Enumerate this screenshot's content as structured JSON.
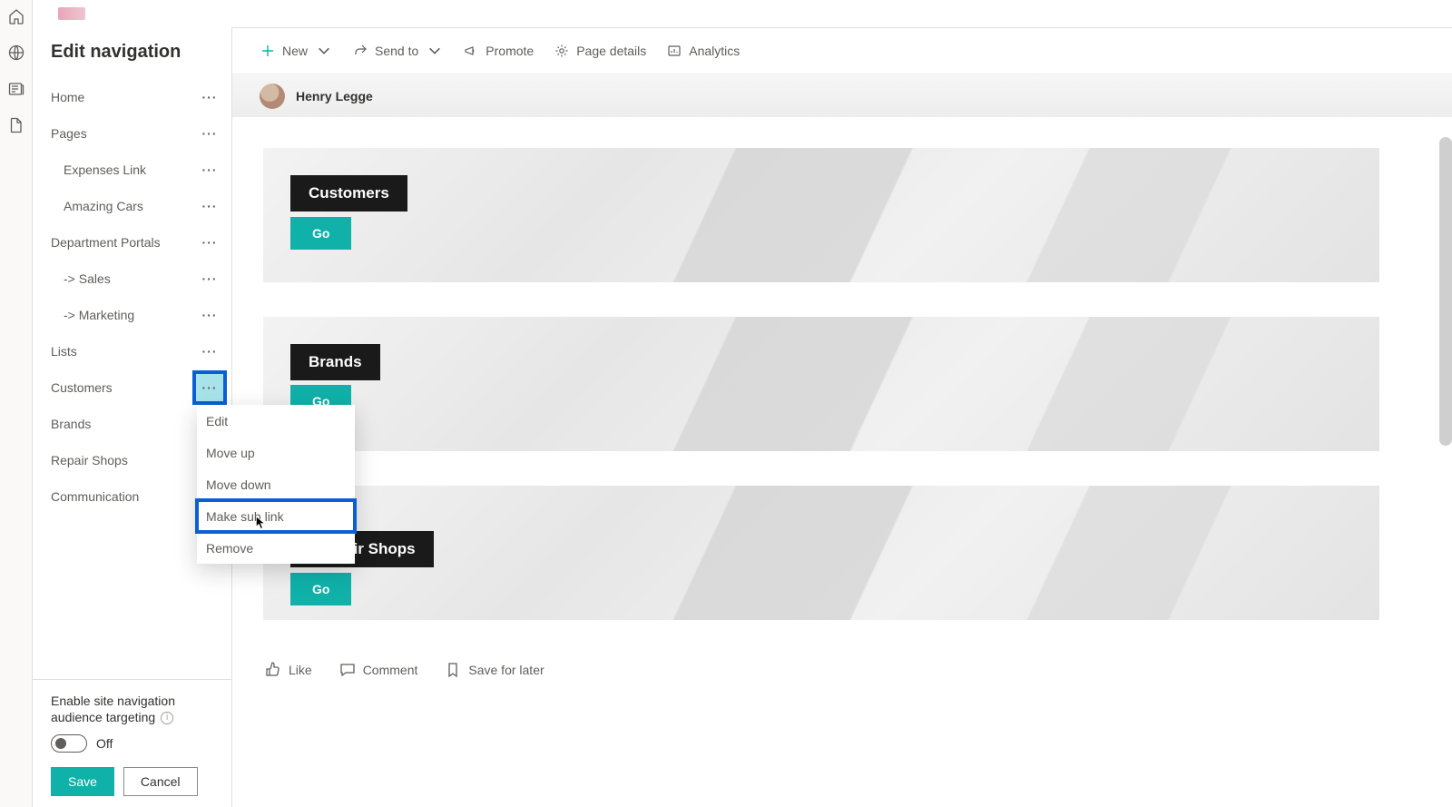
{
  "rail": {
    "items": [
      "home-icon",
      "globe-icon",
      "news-icon",
      "file-icon"
    ]
  },
  "panel": {
    "title": "Edit navigation",
    "items": [
      {
        "label": "Home",
        "indent": 0
      },
      {
        "label": "Pages",
        "indent": 0
      },
      {
        "label": "Expenses Link",
        "indent": 1
      },
      {
        "label": "Amazing Cars",
        "indent": 1
      },
      {
        "label": "Department Portals",
        "indent": 0
      },
      {
        "label": "-> Sales",
        "indent": 1
      },
      {
        "label": "-> Marketing",
        "indent": 1
      },
      {
        "label": "Lists",
        "indent": 0
      },
      {
        "label": "Customers",
        "indent": 0,
        "highlight": true
      },
      {
        "label": "Brands",
        "indent": 0
      },
      {
        "label": "Repair Shops",
        "indent": 0
      },
      {
        "label": "Communication",
        "indent": 0
      }
    ],
    "targeting": {
      "line1": "Enable site navigation",
      "line2": "audience targeting",
      "state": "Off"
    },
    "save": "Save",
    "cancel": "Cancel"
  },
  "contextMenu": {
    "items": [
      "Edit",
      "Move up",
      "Move down",
      "Make sub link",
      "Remove"
    ],
    "highlightIndex": 3
  },
  "commandBar": {
    "new": "New",
    "sendto": "Send to",
    "promote": "Promote",
    "pagedetails": "Page details",
    "analytics": "Analytics"
  },
  "author": {
    "name": "Henry Legge"
  },
  "tiles": [
    {
      "title": "Customers",
      "button": "Go"
    },
    {
      "title": "Brands",
      "button": "Go"
    },
    {
      "title": "Repair Shops",
      "button": "Go"
    }
  ],
  "social": {
    "like": "Like",
    "comment": "Comment",
    "save": "Save for later"
  }
}
